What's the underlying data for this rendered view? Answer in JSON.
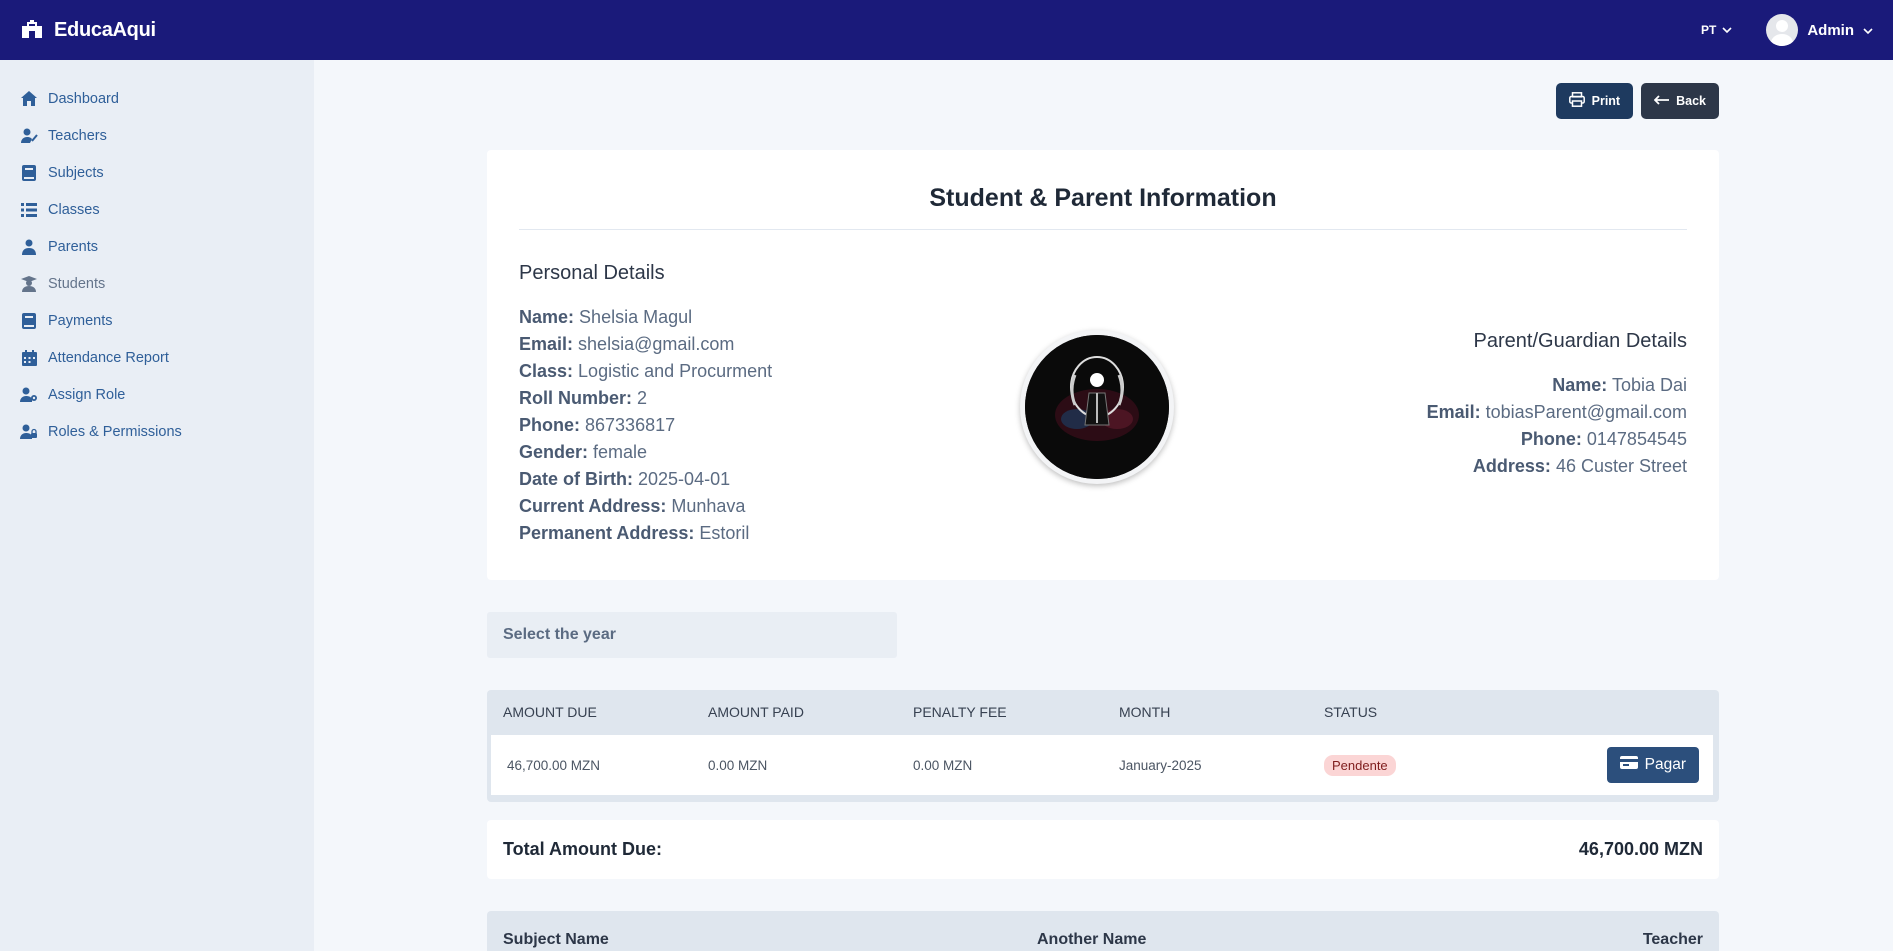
{
  "app": {
    "brand": "EducaAqui",
    "language": "PT",
    "user": "Admin"
  },
  "sidebar": {
    "items": [
      {
        "label": "Dashboard",
        "icon": "home-icon"
      },
      {
        "label": "Teachers",
        "icon": "teacher-icon"
      },
      {
        "label": "Subjects",
        "icon": "book-icon"
      },
      {
        "label": "Classes",
        "icon": "list-icon"
      },
      {
        "label": "Parents",
        "icon": "parent-icon"
      },
      {
        "label": "Students",
        "icon": "student-icon"
      },
      {
        "label": "Payments",
        "icon": "payment-icon"
      },
      {
        "label": "Attendance Report",
        "icon": "calendar-icon"
      },
      {
        "label": "Assign Role",
        "icon": "user-gear-icon"
      },
      {
        "label": "Roles & Permissions",
        "icon": "user-lock-icon"
      }
    ]
  },
  "actions": {
    "print": "Print",
    "back": "Back"
  },
  "card": {
    "title": "Student & Parent Information",
    "personal_heading": "Personal Details",
    "personal": [
      {
        "label": "Name:",
        "value": "Shelsia Magul"
      },
      {
        "label": "Email:",
        "value": "shelsia@gmail.com"
      },
      {
        "label": "Class:",
        "value": "Logistic and Procurment"
      },
      {
        "label": "Roll Number:",
        "value": "2"
      },
      {
        "label": "Phone:",
        "value": "867336817"
      },
      {
        "label": "Gender:",
        "value": "female"
      },
      {
        "label": "Date of Birth:",
        "value": "2025-04-01"
      },
      {
        "label": "Current Address:",
        "value": "Munhava"
      },
      {
        "label": "Permanent Address:",
        "value": "Estoril"
      }
    ],
    "guardian_heading": "Parent/Guardian Details",
    "guardian": [
      {
        "label": "Name:",
        "value": "Tobia Dai"
      },
      {
        "label": "Email:",
        "value": "tobiasParent@gmail.com"
      },
      {
        "label": "Phone:",
        "value": "0147854545"
      },
      {
        "label": "Address:",
        "value": "46 Custer Street"
      }
    ]
  },
  "year_select": {
    "placeholder": "Select the year"
  },
  "payments": {
    "headers": [
      "AMOUNT DUE",
      "AMOUNT PAID",
      "PENALTY FEE",
      "MONTH",
      "STATUS"
    ],
    "rows": [
      {
        "amount_due": "46,700.00 MZN",
        "amount_paid": "0.00 MZN",
        "penalty_fee": "0.00 MZN",
        "month": "January-2025",
        "status": "Pendente",
        "action": "Pagar"
      }
    ]
  },
  "total": {
    "label": "Total Amount Due:",
    "value": "46,700.00 MZN"
  },
  "subjects_table": {
    "headers": [
      "Subject Name",
      "Another Name",
      "Teacher"
    ]
  },
  "colors": {
    "topbar": "#1a1a7a",
    "sidebar": "#e9eef5",
    "nav_link": "#2f5f99",
    "pending_badge": "#fbd5d5",
    "pay_button": "#2c4f7c"
  }
}
